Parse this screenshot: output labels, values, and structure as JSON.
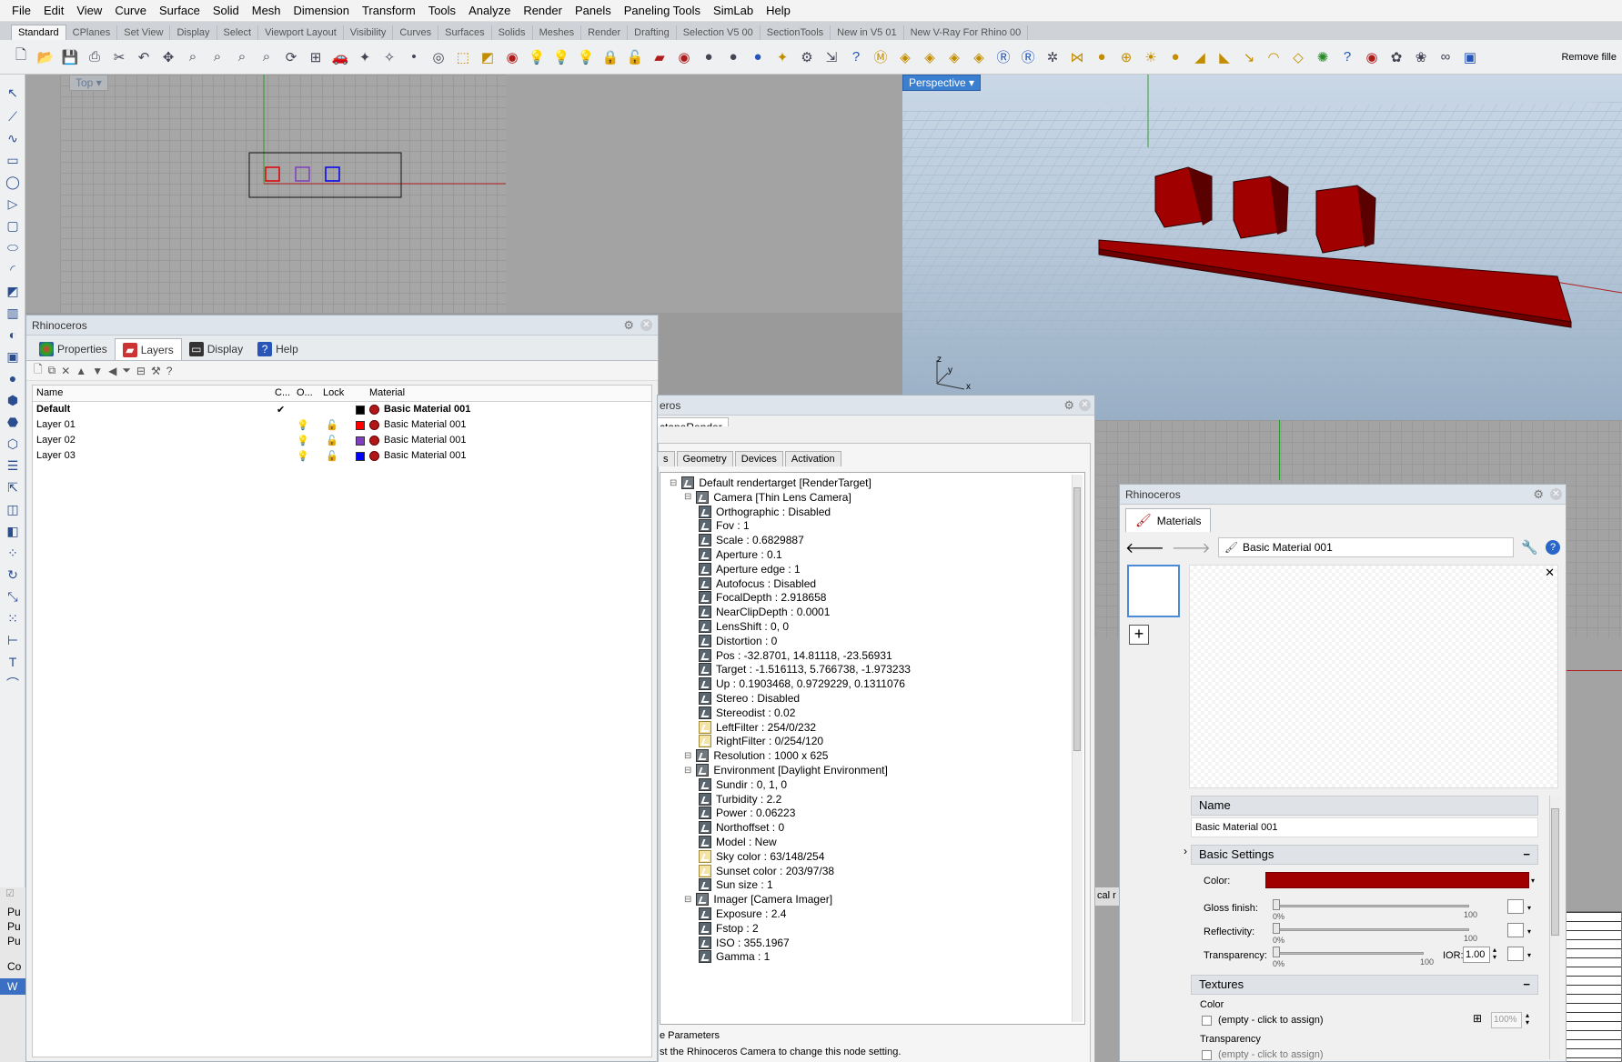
{
  "menubar": [
    "File",
    "Edit",
    "View",
    "Curve",
    "Surface",
    "Solid",
    "Mesh",
    "Dimension",
    "Transform",
    "Tools",
    "Analyze",
    "Render",
    "Panels",
    "Paneling Tools",
    "SimLab",
    "Help"
  ],
  "tabs": [
    "Standard",
    "CPlanes",
    "Set View",
    "Display",
    "Select",
    "Viewport Layout",
    "Visibility",
    "Curves",
    "Surfaces",
    "Solids",
    "Meshes",
    "Render",
    "Drafting",
    "Selection V5 00",
    "SectionTools",
    "New in V5 01",
    "New V-Ray For Rhino 00"
  ],
  "toolbar": {
    "remove_label": "Remove fille"
  },
  "viewports": {
    "top_label": "Top",
    "perspective_label": "Perspective",
    "axis_z": "z",
    "axis_y": "y",
    "axis_x": "x"
  },
  "colors": {
    "material_red": "#a00000",
    "layer01": "#ff0000",
    "layer02": "#7f3fbf",
    "layer03": "#0000ff",
    "default": "#000000"
  },
  "layers_panel": {
    "title": "Rhinoceros",
    "tabs": [
      "Properties",
      "Layers",
      "Display",
      "Help"
    ],
    "columns": {
      "name": "Name",
      "current": "C...",
      "on": "O...",
      "lock": "Lock",
      "material": "Material"
    },
    "rows": [
      {
        "name": "Default",
        "current": "✔",
        "material": "Basic Material 001",
        "color": "#000000"
      },
      {
        "name": "Layer 01",
        "material": "Basic Material 001",
        "color": "#ff0000"
      },
      {
        "name": "Layer 02",
        "material": "Basic Material 001",
        "color": "#7f3fbf"
      },
      {
        "name": "Layer 03",
        "material": "Basic Material 001",
        "color": "#0000ff"
      }
    ]
  },
  "left_stubs": [
    "Pu",
    "Pu",
    "Pu",
    "Co",
    "W"
  ],
  "octane_panel": {
    "title": "eros",
    "tab": "ctaneRender",
    "subtabs": [
      "s",
      "Geometry",
      "Devices",
      "Activation"
    ],
    "tree": [
      {
        "text": "Default rendertarget  [RenderTarget]",
        "level": 0
      },
      {
        "text": "Camera  [Thin Lens Camera]",
        "level": 1
      },
      {
        "text": "Orthographic : Disabled",
        "level": 2
      },
      {
        "text": "Fov : 1",
        "level": 2
      },
      {
        "text": "Scale : 0.6829887",
        "level": 2
      },
      {
        "text": "Aperture : 0.1",
        "level": 2
      },
      {
        "text": "Aperture edge : 1",
        "level": 2
      },
      {
        "text": "Autofocus : Disabled",
        "level": 2
      },
      {
        "text": "FocalDepth : 2.918658",
        "level": 2
      },
      {
        "text": "NearClipDepth : 0.0001",
        "level": 2
      },
      {
        "text": "LensShift : 0, 0",
        "level": 2
      },
      {
        "text": "Distortion : 0",
        "level": 2
      },
      {
        "text": "Pos : -32.8701, 14.81118, -23.56931",
        "level": 2
      },
      {
        "text": "Target : -1.516113, 5.766738, -1.973233",
        "level": 2
      },
      {
        "text": "Up : 0.1903468, 0.9729229, 0.1311076",
        "level": 2
      },
      {
        "text": "Stereo : Disabled",
        "level": 2
      },
      {
        "text": "Stereodist : 0.02",
        "level": 2
      },
      {
        "text": "LeftFilter : 254/0/232",
        "level": 2,
        "filter": true
      },
      {
        "text": "RightFilter : 0/254/120",
        "level": 2,
        "filter": true
      },
      {
        "text": "Resolution : 1000 x 625",
        "level": 1
      },
      {
        "text": "Environment  [Daylight Environment]",
        "level": 1
      },
      {
        "text": "Sundir : 0, 1, 0",
        "level": 2
      },
      {
        "text": "Turbidity : 2.2",
        "level": 2
      },
      {
        "text": "Power : 0.06223",
        "level": 2
      },
      {
        "text": "Northoffset : 0",
        "level": 2
      },
      {
        "text": "Model : New",
        "level": 2
      },
      {
        "text": "Sky color : 63/148/254",
        "level": 2,
        "filter": true
      },
      {
        "text": "Sunset color : 203/97/38",
        "level": 2,
        "filter": true
      },
      {
        "text": "Sun size : 1",
        "level": 2
      },
      {
        "text": "Imager  [Camera Imager]",
        "level": 1
      },
      {
        "text": "Exposure : 2.4",
        "level": 2
      },
      {
        "text": "Fstop : 2",
        "level": 2
      },
      {
        "text": "ISO : 355.1967",
        "level": 2
      },
      {
        "text": "Gamma : 1",
        "level": 2
      }
    ],
    "footer_title": "e Parameters",
    "footer_text": "st the Rhinoceros Camera to change this node setting."
  },
  "materials_panel": {
    "title": "Rhinoceros",
    "tab": "Materials",
    "breadcrumb": "Basic Material 001",
    "name_header": "Name",
    "name_value": "Basic Material 001",
    "basic_header": "Basic Settings",
    "color_label": "Color:",
    "gloss_label": "Gloss finish:",
    "reflect_label": "Reflectivity:",
    "transp_label": "Transparency:",
    "ior_label": "IOR:",
    "ior_value": "1.00",
    "pct0": "0%",
    "pct100": "100",
    "textures_header": "Textures",
    "tex_color_label": "Color",
    "tex_color_value": "(empty - click to assign)",
    "tex_pct": "100%",
    "tex_transp_label": "Transparency",
    "tex_transp_value": "(empty - click to assign)",
    "gloss_value": 0,
    "reflect_value": 0,
    "transp_value": 0
  },
  "right_stub": "cal r"
}
